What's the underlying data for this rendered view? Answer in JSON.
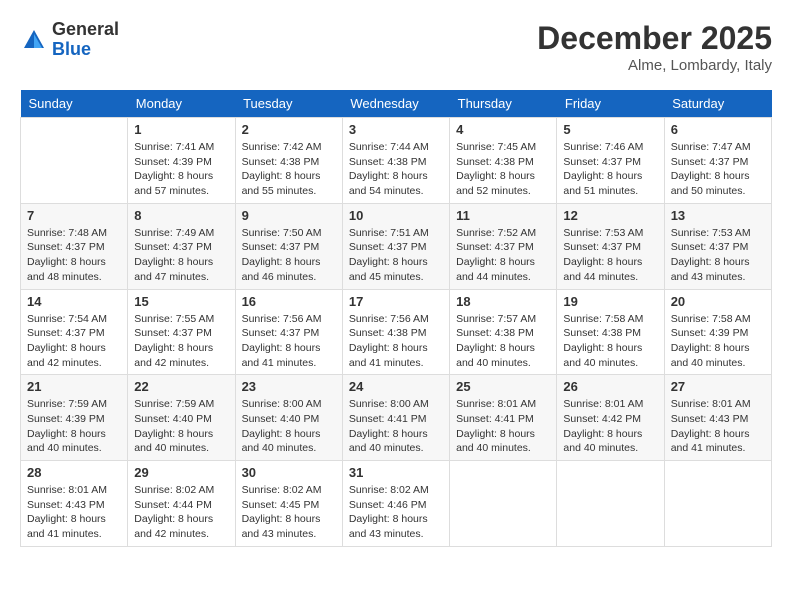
{
  "header": {
    "logo_line1": "General",
    "logo_line2": "Blue",
    "month_year": "December 2025",
    "location": "Alme, Lombardy, Italy"
  },
  "weekdays": [
    "Sunday",
    "Monday",
    "Tuesday",
    "Wednesday",
    "Thursday",
    "Friday",
    "Saturday"
  ],
  "weeks": [
    [
      {
        "day": "",
        "sunrise": "",
        "sunset": "",
        "daylight": ""
      },
      {
        "day": "1",
        "sunrise": "Sunrise: 7:41 AM",
        "sunset": "Sunset: 4:39 PM",
        "daylight": "Daylight: 8 hours and 57 minutes."
      },
      {
        "day": "2",
        "sunrise": "Sunrise: 7:42 AM",
        "sunset": "Sunset: 4:38 PM",
        "daylight": "Daylight: 8 hours and 55 minutes."
      },
      {
        "day": "3",
        "sunrise": "Sunrise: 7:44 AM",
        "sunset": "Sunset: 4:38 PM",
        "daylight": "Daylight: 8 hours and 54 minutes."
      },
      {
        "day": "4",
        "sunrise": "Sunrise: 7:45 AM",
        "sunset": "Sunset: 4:38 PM",
        "daylight": "Daylight: 8 hours and 52 minutes."
      },
      {
        "day": "5",
        "sunrise": "Sunrise: 7:46 AM",
        "sunset": "Sunset: 4:37 PM",
        "daylight": "Daylight: 8 hours and 51 minutes."
      },
      {
        "day": "6",
        "sunrise": "Sunrise: 7:47 AM",
        "sunset": "Sunset: 4:37 PM",
        "daylight": "Daylight: 8 hours and 50 minutes."
      }
    ],
    [
      {
        "day": "7",
        "sunrise": "Sunrise: 7:48 AM",
        "sunset": "Sunset: 4:37 PM",
        "daylight": "Daylight: 8 hours and 48 minutes."
      },
      {
        "day": "8",
        "sunrise": "Sunrise: 7:49 AM",
        "sunset": "Sunset: 4:37 PM",
        "daylight": "Daylight: 8 hours and 47 minutes."
      },
      {
        "day": "9",
        "sunrise": "Sunrise: 7:50 AM",
        "sunset": "Sunset: 4:37 PM",
        "daylight": "Daylight: 8 hours and 46 minutes."
      },
      {
        "day": "10",
        "sunrise": "Sunrise: 7:51 AM",
        "sunset": "Sunset: 4:37 PM",
        "daylight": "Daylight: 8 hours and 45 minutes."
      },
      {
        "day": "11",
        "sunrise": "Sunrise: 7:52 AM",
        "sunset": "Sunset: 4:37 PM",
        "daylight": "Daylight: 8 hours and 44 minutes."
      },
      {
        "day": "12",
        "sunrise": "Sunrise: 7:53 AM",
        "sunset": "Sunset: 4:37 PM",
        "daylight": "Daylight: 8 hours and 44 minutes."
      },
      {
        "day": "13",
        "sunrise": "Sunrise: 7:53 AM",
        "sunset": "Sunset: 4:37 PM",
        "daylight": "Daylight: 8 hours and 43 minutes."
      }
    ],
    [
      {
        "day": "14",
        "sunrise": "Sunrise: 7:54 AM",
        "sunset": "Sunset: 4:37 PM",
        "daylight": "Daylight: 8 hours and 42 minutes."
      },
      {
        "day": "15",
        "sunrise": "Sunrise: 7:55 AM",
        "sunset": "Sunset: 4:37 PM",
        "daylight": "Daylight: 8 hours and 42 minutes."
      },
      {
        "day": "16",
        "sunrise": "Sunrise: 7:56 AM",
        "sunset": "Sunset: 4:37 PM",
        "daylight": "Daylight: 8 hours and 41 minutes."
      },
      {
        "day": "17",
        "sunrise": "Sunrise: 7:56 AM",
        "sunset": "Sunset: 4:38 PM",
        "daylight": "Daylight: 8 hours and 41 minutes."
      },
      {
        "day": "18",
        "sunrise": "Sunrise: 7:57 AM",
        "sunset": "Sunset: 4:38 PM",
        "daylight": "Daylight: 8 hours and 40 minutes."
      },
      {
        "day": "19",
        "sunrise": "Sunrise: 7:58 AM",
        "sunset": "Sunset: 4:38 PM",
        "daylight": "Daylight: 8 hours and 40 minutes."
      },
      {
        "day": "20",
        "sunrise": "Sunrise: 7:58 AM",
        "sunset": "Sunset: 4:39 PM",
        "daylight": "Daylight: 8 hours and 40 minutes."
      }
    ],
    [
      {
        "day": "21",
        "sunrise": "Sunrise: 7:59 AM",
        "sunset": "Sunset: 4:39 PM",
        "daylight": "Daylight: 8 hours and 40 minutes."
      },
      {
        "day": "22",
        "sunrise": "Sunrise: 7:59 AM",
        "sunset": "Sunset: 4:40 PM",
        "daylight": "Daylight: 8 hours and 40 minutes."
      },
      {
        "day": "23",
        "sunrise": "Sunrise: 8:00 AM",
        "sunset": "Sunset: 4:40 PM",
        "daylight": "Daylight: 8 hours and 40 minutes."
      },
      {
        "day": "24",
        "sunrise": "Sunrise: 8:00 AM",
        "sunset": "Sunset: 4:41 PM",
        "daylight": "Daylight: 8 hours and 40 minutes."
      },
      {
        "day": "25",
        "sunrise": "Sunrise: 8:01 AM",
        "sunset": "Sunset: 4:41 PM",
        "daylight": "Daylight: 8 hours and 40 minutes."
      },
      {
        "day": "26",
        "sunrise": "Sunrise: 8:01 AM",
        "sunset": "Sunset: 4:42 PM",
        "daylight": "Daylight: 8 hours and 40 minutes."
      },
      {
        "day": "27",
        "sunrise": "Sunrise: 8:01 AM",
        "sunset": "Sunset: 4:43 PM",
        "daylight": "Daylight: 8 hours and 41 minutes."
      }
    ],
    [
      {
        "day": "28",
        "sunrise": "Sunrise: 8:01 AM",
        "sunset": "Sunset: 4:43 PM",
        "daylight": "Daylight: 8 hours and 41 minutes."
      },
      {
        "day": "29",
        "sunrise": "Sunrise: 8:02 AM",
        "sunset": "Sunset: 4:44 PM",
        "daylight": "Daylight: 8 hours and 42 minutes."
      },
      {
        "day": "30",
        "sunrise": "Sunrise: 8:02 AM",
        "sunset": "Sunset: 4:45 PM",
        "daylight": "Daylight: 8 hours and 43 minutes."
      },
      {
        "day": "31",
        "sunrise": "Sunrise: 8:02 AM",
        "sunset": "Sunset: 4:46 PM",
        "daylight": "Daylight: 8 hours and 43 minutes."
      },
      {
        "day": "",
        "sunrise": "",
        "sunset": "",
        "daylight": ""
      },
      {
        "day": "",
        "sunrise": "",
        "sunset": "",
        "daylight": ""
      },
      {
        "day": "",
        "sunrise": "",
        "sunset": "",
        "daylight": ""
      }
    ]
  ]
}
